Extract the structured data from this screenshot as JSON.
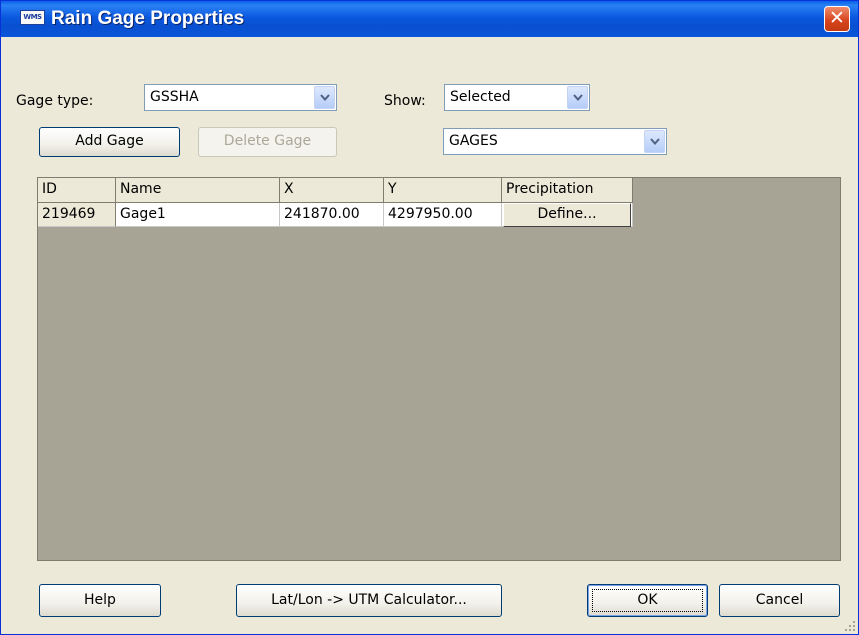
{
  "window": {
    "title": "Rain Gage Properties",
    "app_icon_text": "WMS",
    "close_glyph": "✕"
  },
  "top": {
    "gage_type_label": "Gage type:",
    "gage_type_value": "GSSHA",
    "show_label": "Show:",
    "show_value": "Selected",
    "coverage_value": "GAGES",
    "add_gage": "Add Gage",
    "delete_gage": "Delete Gage"
  },
  "table": {
    "columns": [
      "ID",
      "Name",
      "X",
      "Y",
      "Precipitation"
    ],
    "rows": [
      {
        "id": "219469",
        "name": "Gage1",
        "x": "241870.00",
        "y": "4297950.00",
        "precipitation": "Define..."
      }
    ]
  },
  "bottom": {
    "help": "Help",
    "calculator": "Lat/Lon -> UTM Calculator...",
    "ok": "OK",
    "cancel": "Cancel"
  },
  "colors": {
    "title_bar": "#0a58df",
    "dialog_bg": "#ece9d8",
    "grid_bg": "#a8a495",
    "close_button": "#d8461e"
  },
  "icons": {
    "dropdown": "chevron-down-icon",
    "close": "close-icon",
    "resize": "resize-grip-icon"
  }
}
